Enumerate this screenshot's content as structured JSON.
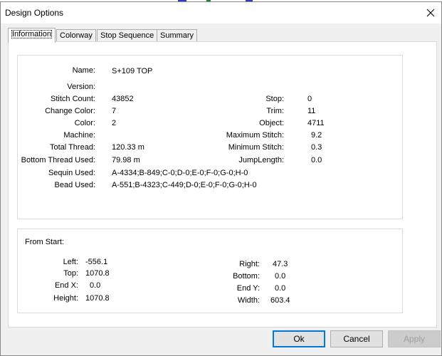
{
  "window": {
    "title": "Design Options"
  },
  "tabs": [
    "Information",
    "Colorway",
    "Stop Sequence",
    "Summary"
  ],
  "info": {
    "name_label": "Name:",
    "name_value": "S+109 TOP",
    "version_label": "Version:",
    "version_value": "",
    "stitch_count_label": "Stitch Count:",
    "stitch_count_value": "43852",
    "change_color_label": "Change Color:",
    "change_color_value": "7",
    "color_label": "Color:",
    "color_value": "2",
    "machine_label": "Machine:",
    "machine_value": "",
    "total_thread_label": "Total Thread:",
    "total_thread_value": "120.33 m",
    "bottom_thread_label": "Bottom Thread Used:",
    "bottom_thread_value": "79.98 m",
    "sequin_label": "Sequin Used:",
    "sequin_value": "A-4334;B-849;C-0;D-0;E-0;F-0;G-0;H-0",
    "bead_label": "Bead Used:",
    "bead_value": "A-551;B-4323;C-449;D-0;E-0;F-0;G-0;H-0",
    "stop_label": "Stop:",
    "stop_value": "0",
    "trim_label": "Trim:",
    "trim_value": "11",
    "object_label": "Object:",
    "object_value": "4711",
    "max_stitch_label": "Maximum Stitch:",
    "max_stitch_value": "9.2",
    "min_stitch_label": "Minimum Stitch:",
    "min_stitch_value": "0.3",
    "jump_length_label": "JumpLength:",
    "jump_length_value": "0.0"
  },
  "from_start": {
    "title": "From Start:",
    "left_label": "Left:",
    "left_value": "-556.1",
    "top_label": "Top:",
    "top_value": "1070.8",
    "end_x_label": "End X:",
    "end_x_value": "0.0",
    "height_label": "Height:",
    "height_value": "1070.8",
    "right_label": "Right:",
    "right_value": "47.3",
    "bottom_label": "Bottom:",
    "bottom_value": "0.0",
    "end_y_label": "End Y:",
    "end_y_value": "0.0",
    "width_label": "Width:",
    "width_value": "603.4"
  },
  "buttons": {
    "ok": "Ok",
    "cancel": "Cancel",
    "apply": "Apply"
  },
  "colors": {
    "default_button_border": "#0078d7",
    "panel_bg": "#ffffff",
    "dialog_bg": "#f0f0f0"
  },
  "icons": {
    "close": "close-icon"
  }
}
